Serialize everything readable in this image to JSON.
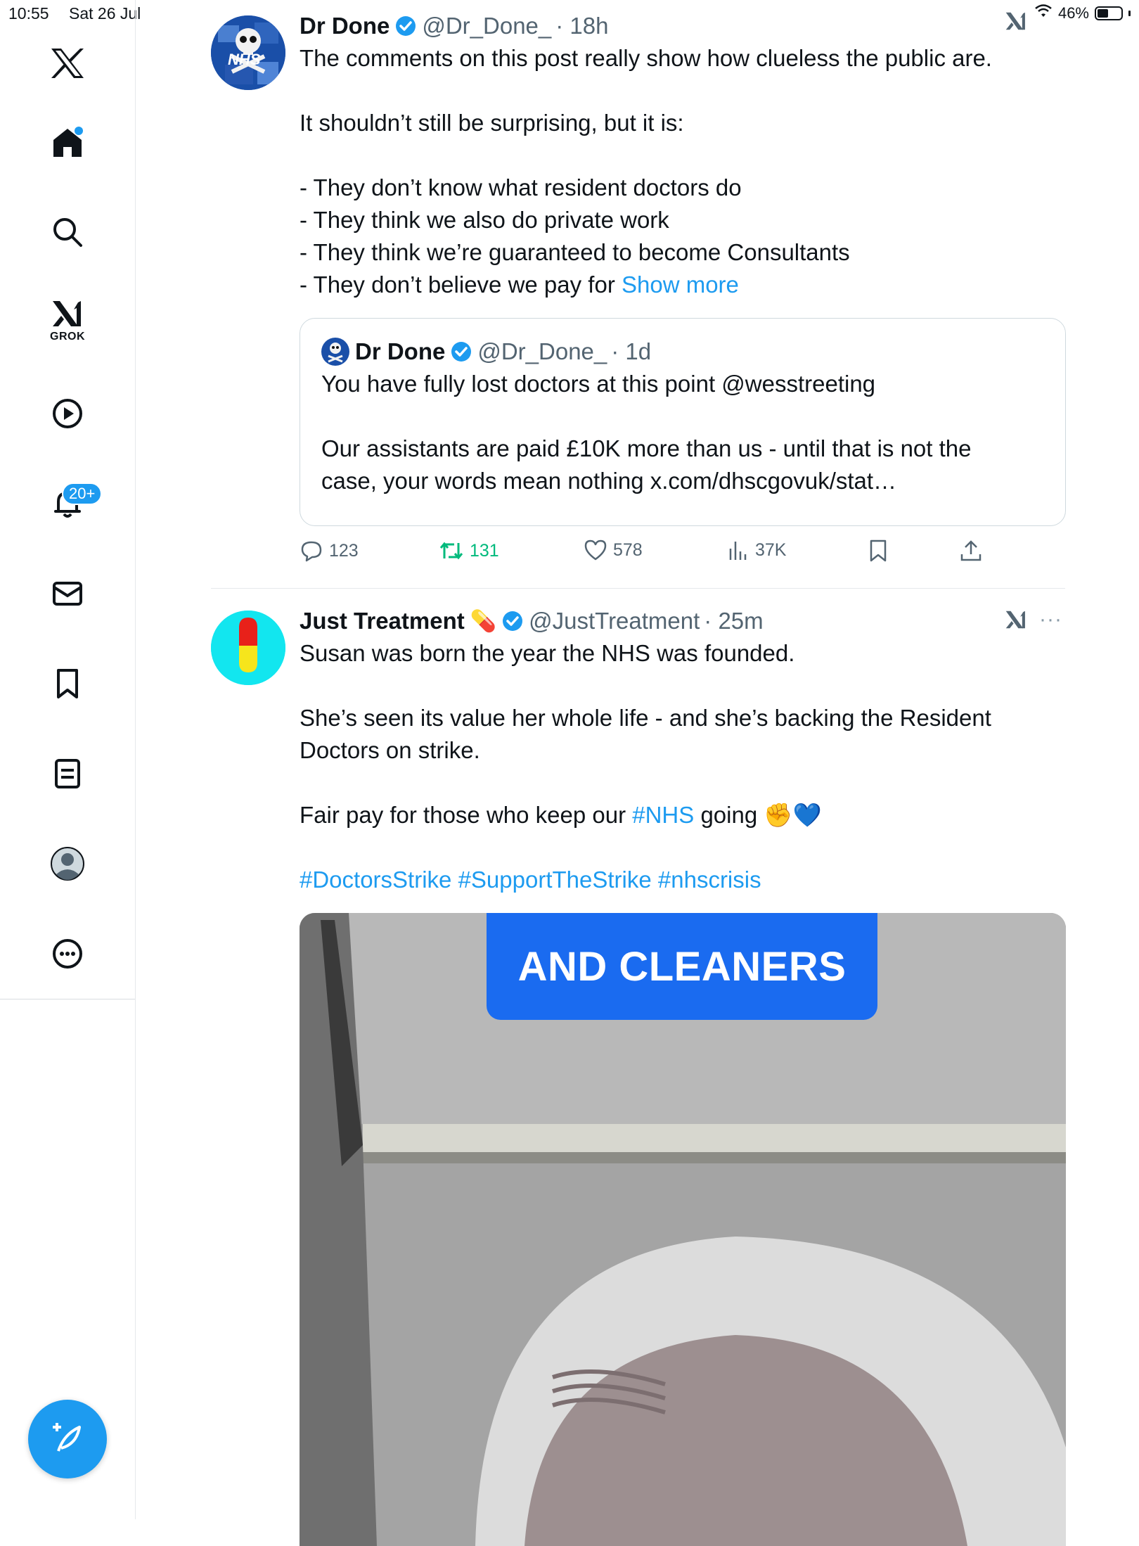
{
  "status_bar": {
    "time": "10:55",
    "date": "Sat 26 Jul",
    "battery": "46%",
    "battery_level": 0.46
  },
  "sidebar": {
    "notifications_badge": "20+",
    "grok_label": "GROK",
    "items": [
      "x-logo",
      "home-icon",
      "search-icon",
      "grok-icon",
      "video-icon",
      "bell-icon",
      "mail-icon",
      "bookmark-icon",
      "lists-icon",
      "profile-icon",
      "more-icon"
    ]
  },
  "tweets": [
    {
      "name": "Dr Done",
      "handle": "@Dr_Done_",
      "time": "· 18h",
      "lines": [
        "The comments on this post really show how clueless the public are.",
        "",
        "It shouldn’t still be surprising, but it is:",
        "",
        "- They don’t know what resident doctors do",
        "- They think we also do private work",
        "- They think we’re guaranteed to become Consultants",
        "- They don’t believe we pay for"
      ],
      "show_more": "Show more",
      "quote": {
        "name": "Dr Done",
        "handle": "@Dr_Done_",
        "time": "· 1d",
        "line1": "You have fully lost doctors at this point @wesstreeting",
        "line2": "Our assistants are paid £10K more than us - until that is not the",
        "line3": "case, your words mean nothing x.com/dhscgovuk/stat…"
      },
      "metrics": {
        "replies": "123",
        "reposts": "131",
        "likes": "578",
        "views": "37K"
      },
      "avatar_text": "NHS"
    },
    {
      "name": "Just Treatment",
      "handle": "@JustTreatment",
      "time": "· 25m",
      "name_emoji": "💊",
      "line1": "Susan was born the year the NHS was founded.",
      "line2": "She’s seen its value her whole life - and she’s backing the Resident",
      "line3": "Doctors on strike.",
      "line4_pre": "Fair pay for those who keep our ",
      "line4_tag": "#NHS",
      "line4_post": " going ✊💙",
      "hashtags": "#DoctorsStrike #SupportTheStrike #nhscrisis",
      "media_caption": "AND CLEANERS"
    }
  ],
  "colors": {
    "accent": "#1d9bf0",
    "repost": "#00ba7c",
    "secondary_text": "#536471",
    "caption_bg": "#1a6bf0"
  }
}
